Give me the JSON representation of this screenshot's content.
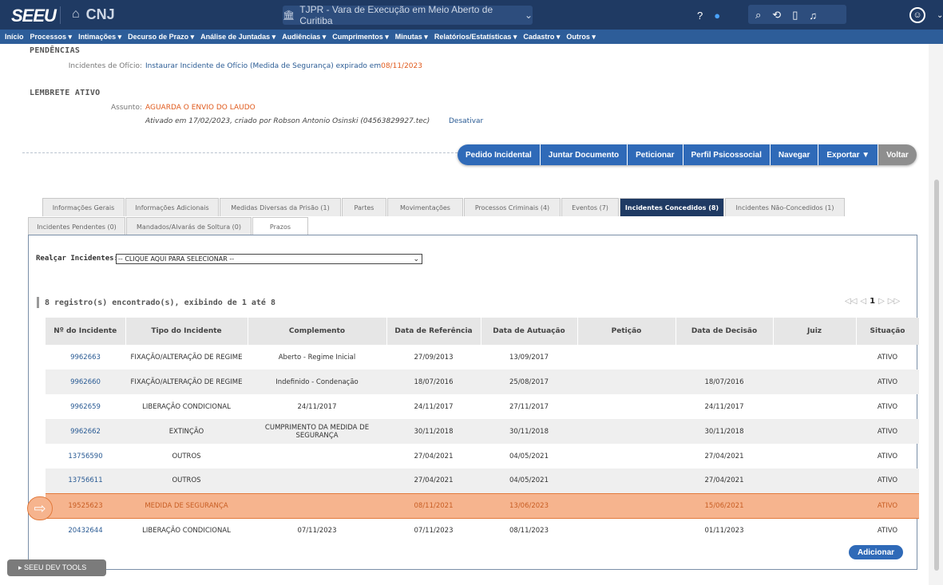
{
  "topbar": {
    "logo": "SEEU",
    "cnj": "CNJ",
    "court": "TJPR - Vara de Execução em Meio Aberto de Curitiba"
  },
  "menu": [
    "Início",
    "Processos ▾",
    "Intimações ▾",
    "Decurso de Prazo ▾",
    "Análise de Juntadas ▾",
    "Audiências ▾",
    "Cumprimentos ▾",
    "Minutas ▾",
    "Relatórios/Estatísticas ▾",
    "Cadastro ▾",
    "Outros ▾"
  ],
  "pendencias": {
    "title": "PENDÊNCIAS",
    "label": "Incidentes de Ofício:",
    "text": "Instaurar Incidente de Ofício (Medida de Segurança) expirado em",
    "date": "08/11/2023"
  },
  "lembrete": {
    "title": "LEMBRETE ATIVO",
    "label": "Assunto:",
    "assunto": "AGUARDA O ENVIO DO LAUDO",
    "ativado": "Ativado em 17/02/2023, criado por Robson Antonio Osinski (04563829927.tec)",
    "desativar": "Desativar"
  },
  "actions": [
    "Pedido Incidental",
    "Juntar Documento",
    "Peticionar",
    "Perfil Psicossocial",
    "Navegar",
    "Exportar ▼",
    "Voltar"
  ],
  "tabs_row1": [
    "Informações Gerais",
    "Informações Adicionais",
    "Medidas Diversas da Prisão (1)",
    "Partes",
    "Movimentações",
    "Processos Criminais (4)",
    "Eventos (7)",
    "Incidentes Concedidos (8)",
    "Incidentes Não-Concedidos (1)"
  ],
  "tabs_row2": [
    "Incidentes Pendentes (0)",
    "Mandados/Alvarás de Soltura (0)",
    "Prazos"
  ],
  "filter": {
    "label": "Realçar Incidentes:",
    "value": "-- CLIQUE AQUI PARA SELECIONAR --"
  },
  "count": "8 registro(s) encontrado(s), exibindo de 1 até 8",
  "pager": {
    "current": "1"
  },
  "table": {
    "headers": [
      "Nº do Incidente",
      "Tipo do Incidente",
      "Complemento",
      "Data de Referência",
      "Data de Autuação",
      "Petição",
      "Data de Decisão",
      "Juiz",
      "Situação"
    ],
    "rows": [
      [
        "9962663",
        "FIXAÇÃO/ALTERAÇÃO DE REGIME",
        "Aberto - Regime Inicial",
        "27/09/2013",
        "13/09/2017",
        "",
        "",
        "",
        "ATIVO"
      ],
      [
        "9962660",
        "FIXAÇÃO/ALTERAÇÃO DE REGIME",
        "Indefinido - Condenação",
        "18/07/2016",
        "25/08/2017",
        "",
        "18/07/2016",
        "",
        "ATIVO"
      ],
      [
        "9962659",
        "LIBERAÇÃO CONDICIONAL",
        "24/11/2017",
        "24/11/2017",
        "27/11/2017",
        "",
        "24/11/2017",
        "",
        "ATIVO"
      ],
      [
        "9962662",
        "EXTINÇÃO",
        "CUMPRIMENTO DA MEDIDA DE SEGURANÇA",
        "30/11/2018",
        "30/11/2018",
        "",
        "30/11/2018",
        "",
        "ATIVO"
      ],
      [
        "13756590",
        "OUTROS",
        "",
        "27/04/2021",
        "04/05/2021",
        "",
        "27/04/2021",
        "",
        "ATIVO"
      ],
      [
        "13756611",
        "OUTROS",
        "",
        "27/04/2021",
        "04/05/2021",
        "",
        "27/04/2021",
        "",
        "ATIVO"
      ],
      [
        "19525623",
        "MEDIDA DE SEGURANÇA",
        "",
        "08/11/2021",
        "13/06/2023",
        "",
        "15/06/2021",
        "",
        "ATIVO"
      ],
      [
        "20432644",
        "LIBERAÇÃO CONDICIONAL",
        "07/11/2023",
        "07/11/2023",
        "08/11/2023",
        "",
        "01/11/2023",
        "",
        "ATIVO"
      ]
    ]
  },
  "add_label": "Adicionar",
  "devtools": "▸ SEEU DEV TOOLS"
}
